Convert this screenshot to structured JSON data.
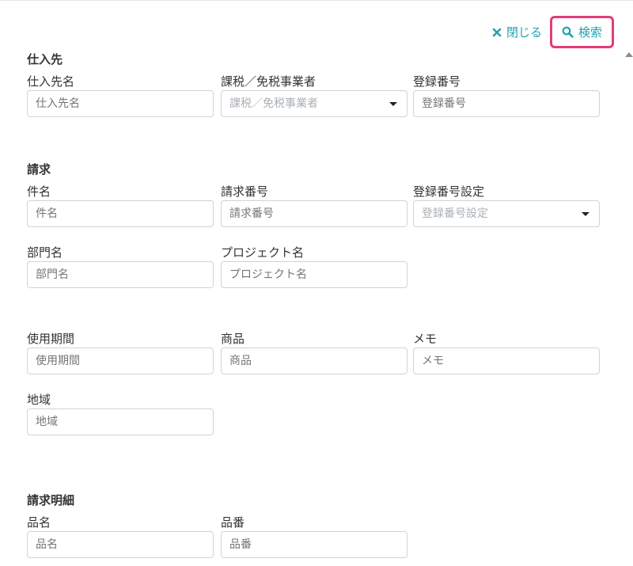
{
  "toolbar": {
    "close_label": "閉じる",
    "search_label": "検索"
  },
  "sections": {
    "supplier": {
      "title": "仕入先",
      "name": {
        "label": "仕入先名",
        "placeholder": "仕入先名"
      },
      "tax_status": {
        "label": "課税／免税事業者",
        "placeholder": "課税／免税事業者"
      },
      "registration_no": {
        "label": "登録番号",
        "placeholder": "登録番号"
      }
    },
    "invoice": {
      "title": "請求",
      "subject": {
        "label": "件名",
        "placeholder": "件名"
      },
      "invoice_no": {
        "label": "請求番号",
        "placeholder": "請求番号"
      },
      "reg_setting": {
        "label": "登録番号設定",
        "placeholder": "登録番号設定"
      },
      "department": {
        "label": "部門名",
        "placeholder": "部門名"
      },
      "project": {
        "label": "プロジェクト名",
        "placeholder": "プロジェクト名"
      },
      "usage_period": {
        "label": "使用期間",
        "placeholder": "使用期間"
      },
      "product": {
        "label": "商品",
        "placeholder": "商品"
      },
      "memo": {
        "label": "メモ",
        "placeholder": "メモ"
      },
      "region": {
        "label": "地域",
        "placeholder": "地域"
      }
    },
    "details": {
      "title": "請求明細",
      "item_name": {
        "label": "品名",
        "placeholder": "品名"
      },
      "item_no": {
        "label": "品番",
        "placeholder": "品番"
      }
    }
  }
}
